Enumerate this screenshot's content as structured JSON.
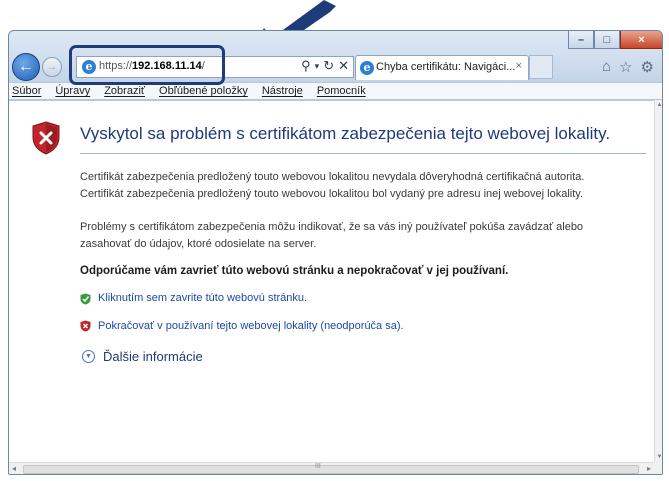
{
  "window": {
    "caption_minimize": "–",
    "caption_maximize": "□",
    "caption_close": "×"
  },
  "address_bar": {
    "url_prefix": "https://",
    "url_host": "192.168.11.14",
    "url_suffix": "/",
    "search_icon": "magnifier-icon",
    "dropdown_icon": "chevron-down-icon",
    "refresh_icon": "refresh-icon",
    "stop_icon": "close-icon"
  },
  "tab": {
    "title": "Chyba certifikátu: Navigáci...",
    "close": "×"
  },
  "right_tools": [
    "home-icon",
    "star-icon",
    "gear-icon"
  ],
  "menu": {
    "items": [
      "Súbor",
      "Úpravy",
      "Zobraziť",
      "Obľúbené položky",
      "Nástroje",
      "Pomocník"
    ]
  },
  "page": {
    "heading": "Vyskytol sa problém s certifikátom zabezpečenia tejto webovej lokality.",
    "para1_line1": "Certifikát zabezpečenia predložený touto webovou lokalitou nevydala dôveryhodná certifikačná autorita.",
    "para1_line2": "Certifikát zabezpečenia predložený touto webovou lokalitou bol vydaný pre adresu inej webovej lokality.",
    "para2_line1": "Problémy s certifikátom zabezpečenia môžu indikovať, že sa vás iný používateľ pokúša zavádzať alebo",
    "para2_line2": "zasahovať do údajov, ktoré odosielate na server.",
    "recommendation": "Odporúčame vám zavrieť túto webovú stránku a nepokračovať v jej používaní.",
    "close_link": "Kliknutím sem zavrite túto webovú stránku.",
    "continue_link": "Pokračovať v používaní tejto webovej lokality (neodporúča sa).",
    "more_info": "Ďalšie informácie"
  },
  "scrollbar": {
    "grip": "III"
  },
  "colors": {
    "accent": "#1e3c7a",
    "link": "#1a4aa8",
    "heading": "#1f3a7a",
    "warning_red": "#c0272d",
    "ok_green": "#3a9a3a"
  }
}
